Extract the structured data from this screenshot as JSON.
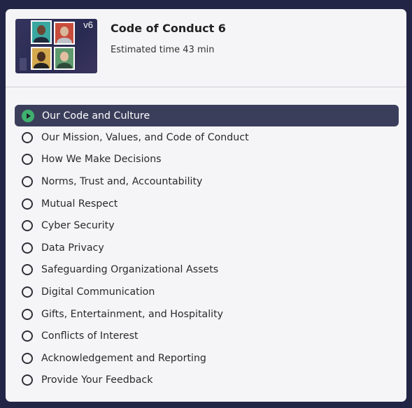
{
  "course": {
    "title": "Code of Conduct 6",
    "estimated_time": "Estimated time 43 min",
    "version_badge": "v6"
  },
  "colors": {
    "background": "#232546",
    "panel": "#f5f5f7",
    "active_row": "#3b3e5b",
    "play_icon": "#3fb16e"
  },
  "modules": [
    {
      "label": "Our Code and Culture",
      "status": "in-progress",
      "icon": "play-circle-icon"
    },
    {
      "label": "Our Mission, Values, and Code of Conduct",
      "status": "not-started",
      "icon": "empty-circle-icon"
    },
    {
      "label": "How We Make Decisions",
      "status": "not-started",
      "icon": "empty-circle-icon"
    },
    {
      "label": "Norms, Trust and, Accountability",
      "status": "not-started",
      "icon": "empty-circle-icon"
    },
    {
      "label": "Mutual Respect",
      "status": "not-started",
      "icon": "empty-circle-icon"
    },
    {
      "label": "Cyber Security",
      "status": "not-started",
      "icon": "empty-circle-icon"
    },
    {
      "label": "Data Privacy",
      "status": "not-started",
      "icon": "empty-circle-icon"
    },
    {
      "label": "Safeguarding Organizational Assets",
      "status": "not-started",
      "icon": "empty-circle-icon"
    },
    {
      "label": "Digital Communication",
      "status": "not-started",
      "icon": "empty-circle-icon"
    },
    {
      "label": "Gifts, Entertainment, and Hospitality",
      "status": "not-started",
      "icon": "empty-circle-icon"
    },
    {
      "label": "Conflicts of Interest",
      "status": "not-started",
      "icon": "empty-circle-icon"
    },
    {
      "label": "Acknowledgement and Reporting",
      "status": "not-started",
      "icon": "empty-circle-icon"
    },
    {
      "label": "Provide Your Feedback",
      "status": "not-started",
      "icon": "empty-circle-icon"
    }
  ]
}
